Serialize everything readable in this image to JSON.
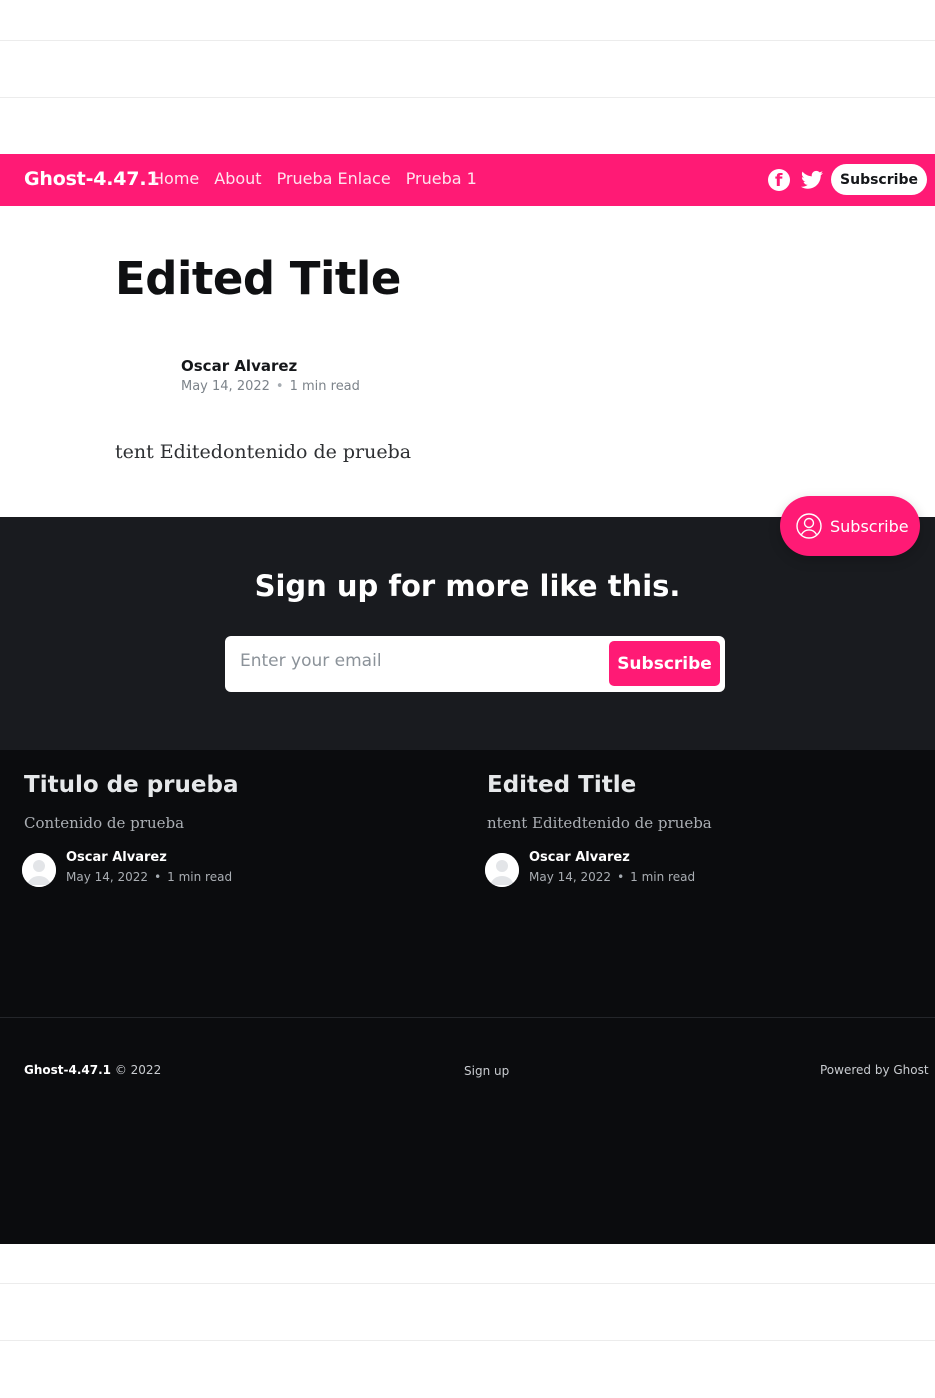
{
  "colors": {
    "accent": "#ff1a75",
    "cta_bg": "#191b1f",
    "footer_bg": "#0b0c0e"
  },
  "nav": {
    "brand": "Ghost-4.47.1",
    "links": [
      "Home",
      "About",
      "Prueba Enlace",
      "Prueba 1"
    ],
    "icons": [
      "facebook-icon",
      "twitter-icon"
    ],
    "subscribe_label": "Subscribe"
  },
  "post": {
    "title": "Edited Title",
    "author": "Oscar Alvarez",
    "date": "May 14, 2022",
    "read_time": "1 min read",
    "body": "tent Editedontenido de prueba"
  },
  "portal": {
    "label": "Subscribe",
    "icon": "user-circle-icon"
  },
  "cta": {
    "title": "Sign up for more like this.",
    "email_placeholder": "Enter your email",
    "button_label": "Subscribe"
  },
  "related": [
    {
      "title": "Titulo de prueba",
      "excerpt": "Contenido de prueba",
      "author": "Oscar Alvarez",
      "date": "May 14, 2022",
      "read_time": "1 min read"
    },
    {
      "title": "Edited Title",
      "excerpt": "ntent Editedtenido de prueba",
      "author": "Oscar Alvarez",
      "date": "May 14, 2022",
      "read_time": "1 min read"
    }
  ],
  "footer": {
    "site": "Ghost-4.47.1",
    "copyright": "© 2022",
    "signup": "Sign up",
    "powered": "Powered by Ghost"
  }
}
